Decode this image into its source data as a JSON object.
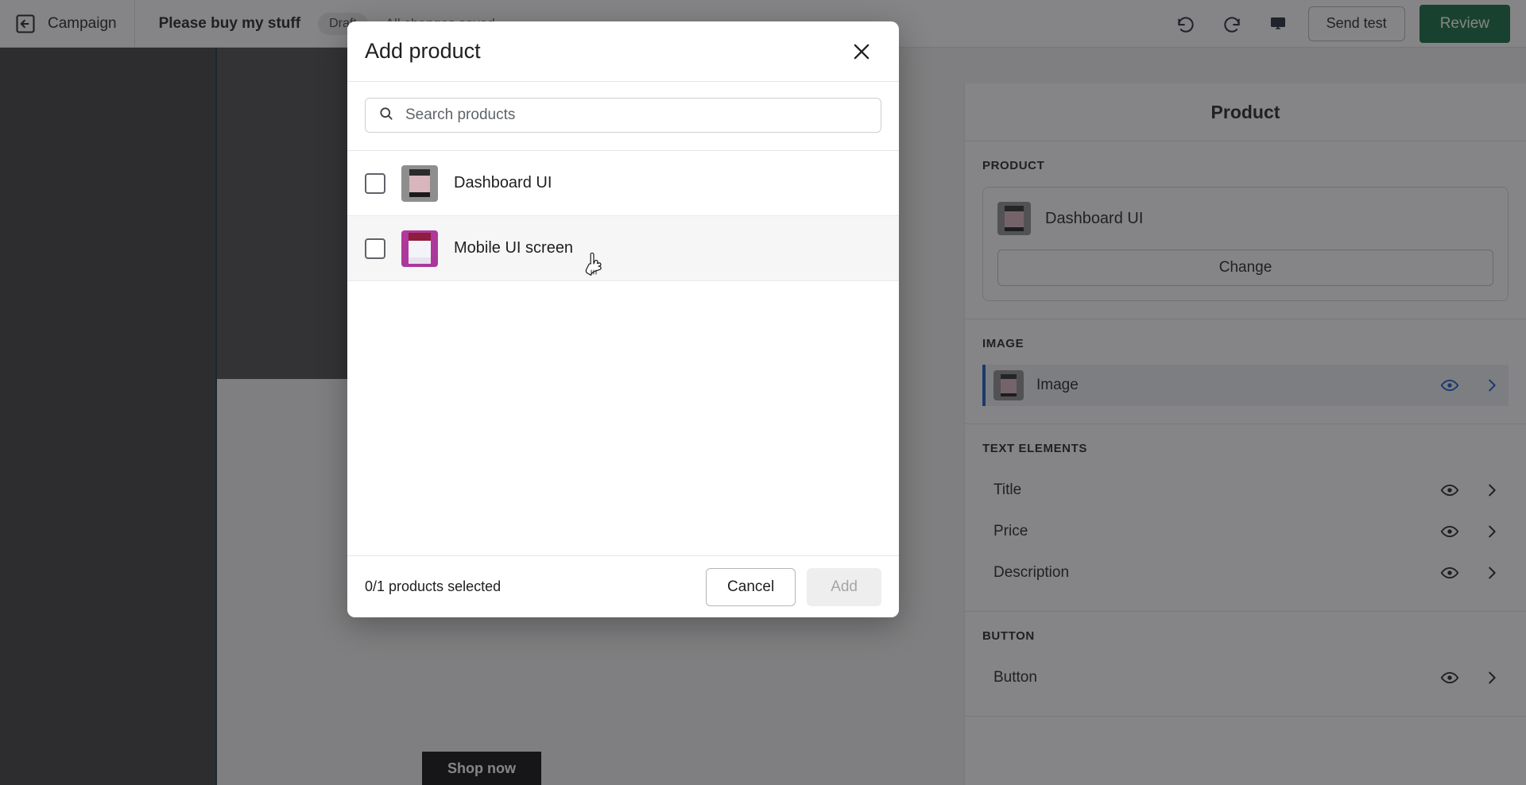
{
  "topbar": {
    "back_icon": "back-arrow-icon",
    "campaign_label": "Campaign",
    "title": "Please buy my stuff",
    "status_badge": "Draft",
    "saved_text": "All changes saved",
    "undo_icon": "undo-icon",
    "redo_icon": "redo-icon",
    "preview_icon": "desktop-preview-icon",
    "send_test_label": "Send test",
    "review_label": "Review",
    "review_color": "#0f6b3d"
  },
  "canvas": {
    "shop_now_label": "Shop now"
  },
  "right_panel": {
    "header_title": "Product",
    "product_section": {
      "label": "PRODUCT",
      "product_name": "Dashboard UI",
      "change_label": "Change"
    },
    "image_section": {
      "label": "IMAGE",
      "item_label": "Image",
      "selected": true,
      "accent_color": "#1a56c4"
    },
    "text_section": {
      "label": "TEXT ELEMENTS",
      "items": [
        {
          "label": "Title"
        },
        {
          "label": "Price"
        },
        {
          "label": "Description"
        }
      ]
    },
    "button_section": {
      "label": "BUTTON",
      "items": [
        {
          "label": "Button"
        }
      ]
    }
  },
  "modal": {
    "title": "Add product",
    "close_icon": "close-icon",
    "search": {
      "icon": "search-icon",
      "placeholder": "Search products",
      "value": ""
    },
    "products": [
      {
        "name": "Dashboard UI",
        "checked": false,
        "hovered": false,
        "thumb": "dashboard-thumbnail"
      },
      {
        "name": "Mobile UI screen",
        "checked": false,
        "hovered": true,
        "thumb": "mobile-thumbnail"
      }
    ],
    "footer": {
      "count_text": "0/1 products selected",
      "cancel_label": "Cancel",
      "add_label": "Add",
      "add_disabled": true
    }
  }
}
